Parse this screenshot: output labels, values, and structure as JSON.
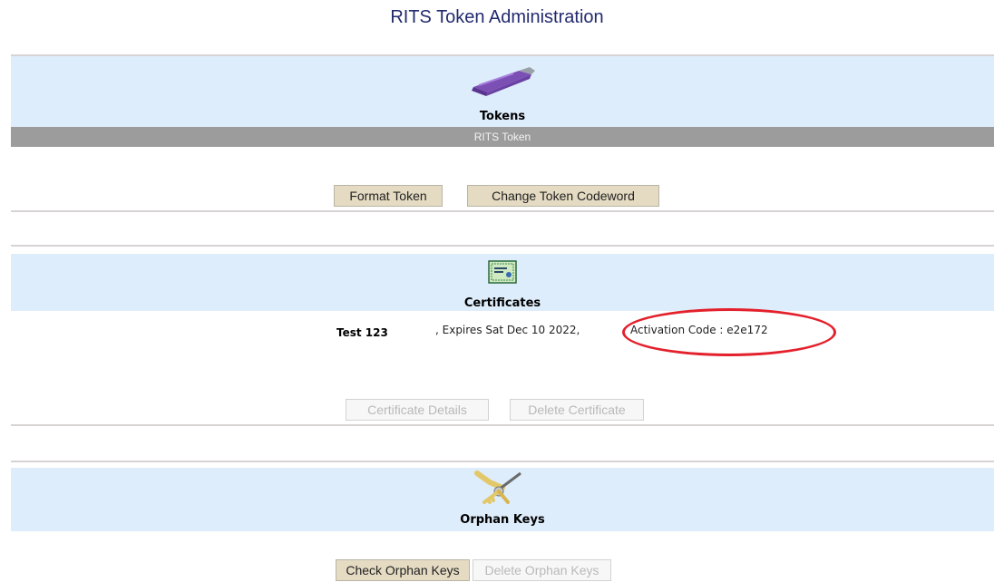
{
  "page": {
    "title": "RITS Token Administration"
  },
  "tokens": {
    "heading": "Tokens",
    "token_bar": "RITS Token",
    "format_label": "Format Token",
    "change_codeword_label": "Change Token Codeword",
    "icon": "usb-token-icon"
  },
  "certificates": {
    "heading": "Certificates",
    "icon": "certificate-icon",
    "entry": {
      "name": "Test 123",
      "expiry": ", Expires Sat Dec 10 2022,",
      "activation": "Activation Code : e2e172"
    },
    "details_label": "Certificate Details",
    "delete_label": "Delete Certificate"
  },
  "orphan_keys": {
    "heading": "Orphan Keys",
    "icon": "keys-icon",
    "check_label": "Check Orphan Keys",
    "delete_label": "Delete Orphan Keys"
  },
  "colors": {
    "band": "#deedfb",
    "title": "#222a6e",
    "button": "#e5dbc3",
    "highlight": "#e3202b"
  }
}
